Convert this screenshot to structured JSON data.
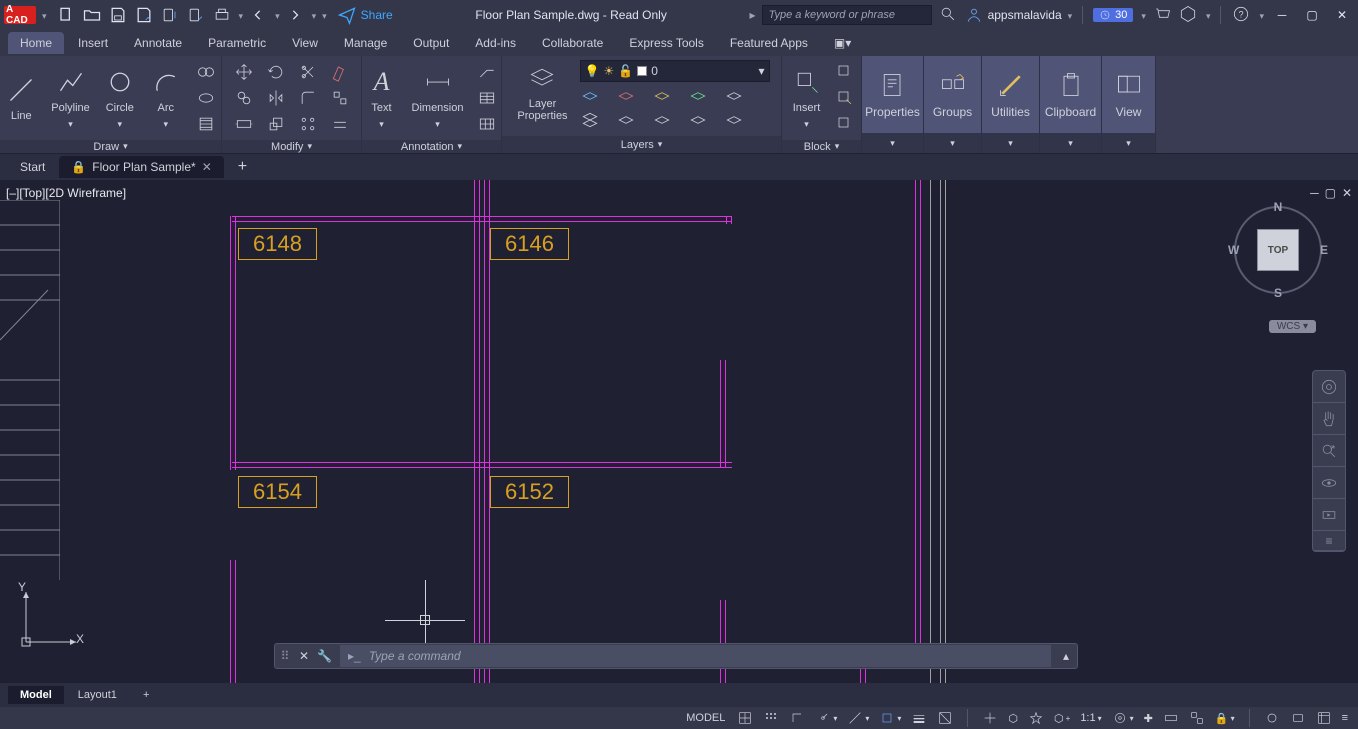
{
  "app_badge": "A CAD",
  "qat_share": "Share",
  "window_title": "Floor Plan Sample.dwg - Read Only",
  "search_placeholder": "Type a keyword or phrase",
  "username": "appsmalavida",
  "trial_days": "30",
  "menu_tabs": [
    "Home",
    "Insert",
    "Annotate",
    "Parametric",
    "View",
    "Manage",
    "Output",
    "Add-ins",
    "Collaborate",
    "Express Tools",
    "Featured Apps"
  ],
  "ribbon": {
    "draw": {
      "title": "Draw",
      "tools": [
        "Line",
        "Polyline",
        "Circle",
        "Arc"
      ]
    },
    "modify": {
      "title": "Modify"
    },
    "annotation": {
      "title": "Annotation",
      "tools": [
        "Text",
        "Dimension"
      ]
    },
    "layers": {
      "title": "Layers",
      "props": "Layer\nProperties",
      "current_layer": "0"
    },
    "block": {
      "title": "Block",
      "insert": "Insert"
    },
    "properties": "Properties",
    "groups": "Groups",
    "utilities": "Utilities",
    "clipboard": "Clipboard",
    "view": "View"
  },
  "file_tabs": {
    "start": "Start",
    "active": "Floor Plan Sample*"
  },
  "view_label": "[–][Top][2D Wireframe]",
  "rooms": {
    "r1": "6148",
    "r2": "6146",
    "r3": "6154",
    "r4": "6152"
  },
  "viewcube": {
    "face": "TOP",
    "n": "N",
    "e": "E",
    "s": "S",
    "w": "W",
    "wcs": "WCS"
  },
  "ucs": {
    "x": "X",
    "y": "Y"
  },
  "cmdline_placeholder": "Type a command",
  "layout_tabs": [
    "Model",
    "Layout1"
  ],
  "statusbar": {
    "model": "MODEL",
    "scale": "1:1"
  }
}
